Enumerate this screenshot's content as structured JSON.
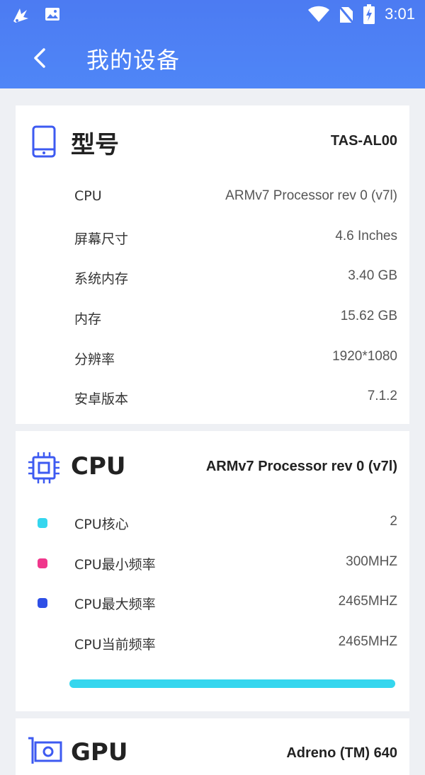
{
  "status_bar": {
    "time": "3:01"
  },
  "header": {
    "title": "我的设备"
  },
  "model_card": {
    "title": "型号",
    "value": "TAS-AL00",
    "rows": [
      {
        "label": "CPU",
        "value": "ARMv7 Processor rev 0 (v7l)"
      },
      {
        "label": "屏幕尺寸",
        "value": "4.6 Inches"
      },
      {
        "label": "系统内存",
        "value": "3.40 GB"
      },
      {
        "label": "内存",
        "value": "15.62 GB"
      },
      {
        "label": "分辨率",
        "value": "1920*1080"
      },
      {
        "label": "安卓版本",
        "value": "7.1.2"
      }
    ]
  },
  "cpu_card": {
    "title": "CPU",
    "value": "ARMv7 Processor rev 0 (v7l)",
    "rows": [
      {
        "label": "CPU核心",
        "value": "2",
        "dot_color": "#35d6ee"
      },
      {
        "label": "CPU最小频率",
        "value": "300MHZ",
        "dot_color": "#f0378c"
      },
      {
        "label": "CPU最大频率",
        "value": "2465MHZ",
        "dot_color": "#2e4fe6"
      },
      {
        "label": "CPU当前频率",
        "value": "2465MHZ"
      }
    ],
    "usage_fraction": 1.0
  },
  "gpu_card": {
    "title": "GPU",
    "value": "Adreno (TM) 640"
  },
  "colors": {
    "accent": "#4f86f7",
    "progress": "#35d6ee"
  }
}
